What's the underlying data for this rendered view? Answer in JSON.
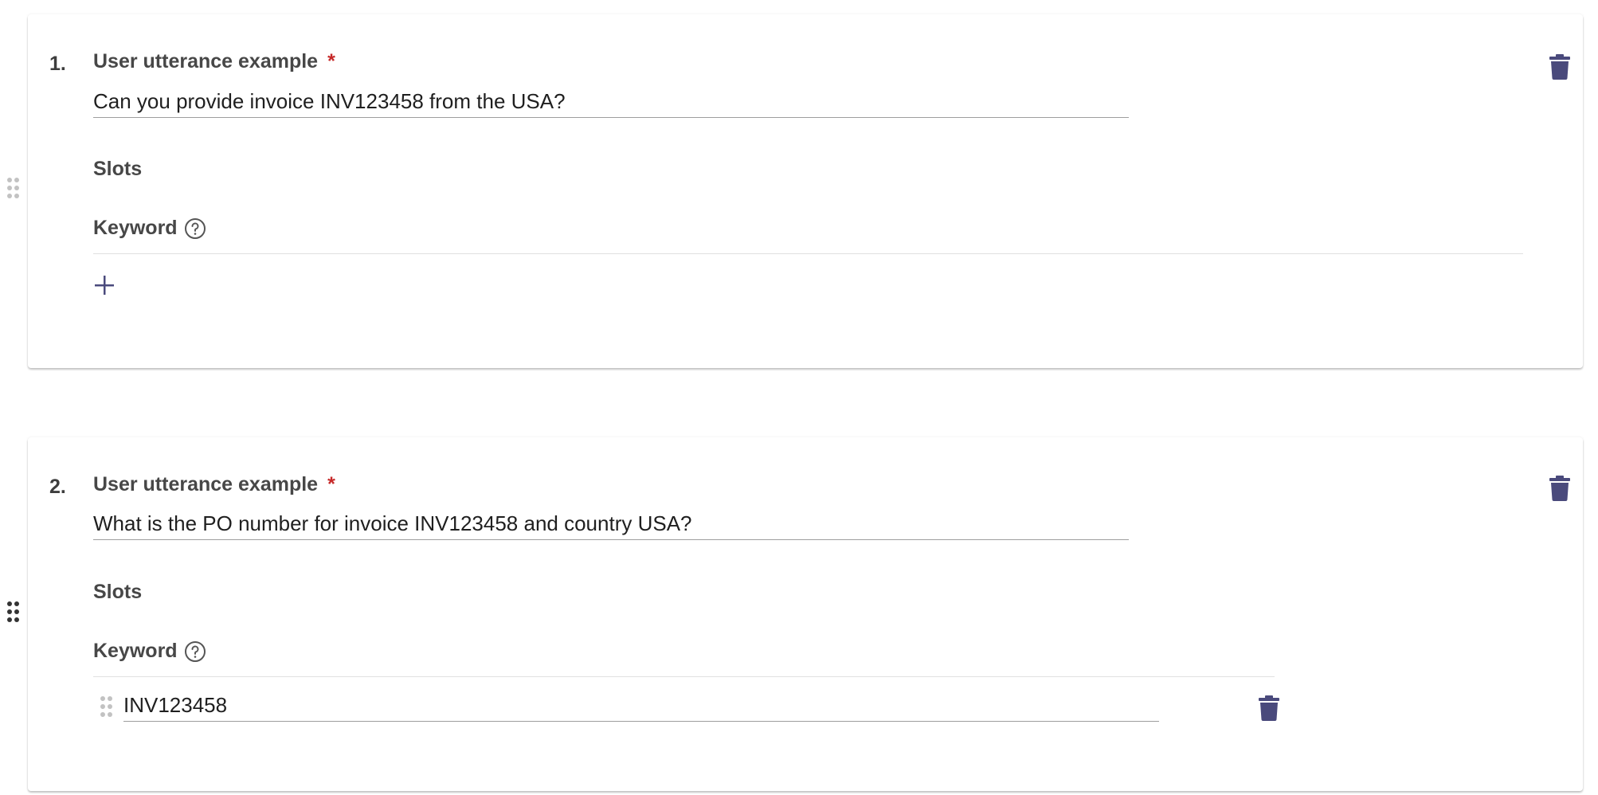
{
  "examples": [
    {
      "index": "1.",
      "label": "User utterance example",
      "required_marker": "*",
      "utterance": "Can you provide invoice INV123458 from the USA?",
      "slots_label": "Slots",
      "keyword_label": "Keyword",
      "keywords": []
    },
    {
      "index": "2.",
      "label": "User utterance example",
      "required_marker": "*",
      "utterance": "What is the PO number for invoice INV123458 and country USA?",
      "slots_label": "Slots",
      "keyword_label": "Keyword",
      "keywords": [
        "INV123458"
      ]
    }
  ],
  "icons": {
    "delete": "trash-icon",
    "help": "help-circle-icon",
    "add": "plus-icon",
    "drag": "drag-handle-icon"
  },
  "colors": {
    "icon_accent": "#4a4a7c",
    "required": "#c62828"
  }
}
